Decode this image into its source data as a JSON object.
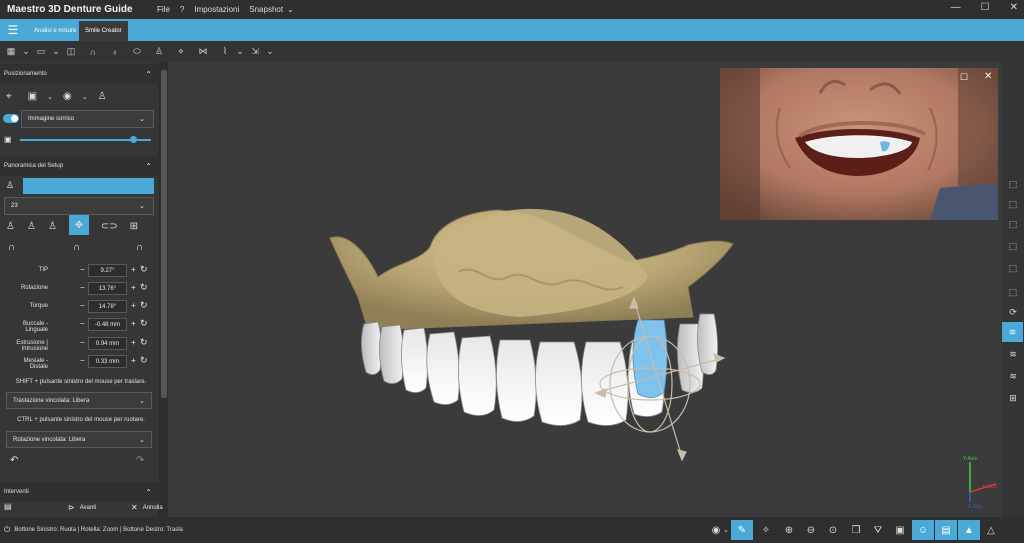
{
  "app": {
    "title": "Maestro 3D Denture Guide"
  },
  "menu": [
    "File",
    "?",
    "Impostazioni",
    "Snapshot"
  ],
  "ribbon_tabs": [
    "Analisi e misure",
    "Smile Creator"
  ],
  "panels": {
    "posizionamento": {
      "title": "Posizionamento",
      "image_select": "Immagine sorriso",
      "opacity_slider": 0.86
    },
    "setup": {
      "title": "Panoramica del Setup",
      "tooth_select": "23",
      "params": [
        {
          "label": "TIP",
          "value": "9.27°"
        },
        {
          "label": "Rotazione",
          "value": "13.76°"
        },
        {
          "label": "Torque",
          "value": "14.78°"
        },
        {
          "label": "Buccale - Linguale",
          "value": "-0.48 mm"
        },
        {
          "label": "Estrusione | Intrusione",
          "value": "0.94 mm"
        },
        {
          "label": "Mesiale - Distale",
          "value": "0.33 mm"
        }
      ],
      "shift_note": "SHIFT + pulsante sinistro del mouse per traslare.",
      "translation_select": "Traslazione vincolata: Libera",
      "ctrl_note": "CTRL + pulsante sinistro del mouse per ruotare.",
      "rotation_select": "Rotazione vincolata: Libera"
    },
    "interventions": {
      "title": "Interventi",
      "next": "Avanti",
      "cancel": "Annulla"
    }
  },
  "status": {
    "text": "Bottone Sinistro: Ruota | Rotella: Zoom | Bottone Destro: Trasla"
  },
  "axes": {
    "y": "Y-Axis",
    "z": "Z-Axis",
    "x": "X-Axis"
  },
  "colors": {
    "accent": "#4aa9d6",
    "gum": "#c4b182",
    "tooth": "#f2f2f2",
    "selected_tooth": "#7ec3ee"
  },
  "icons": {
    "hamburger": "menu-icon",
    "close": "close-icon",
    "maximize": "maximize-icon",
    "minimize": "minimize-icon"
  }
}
